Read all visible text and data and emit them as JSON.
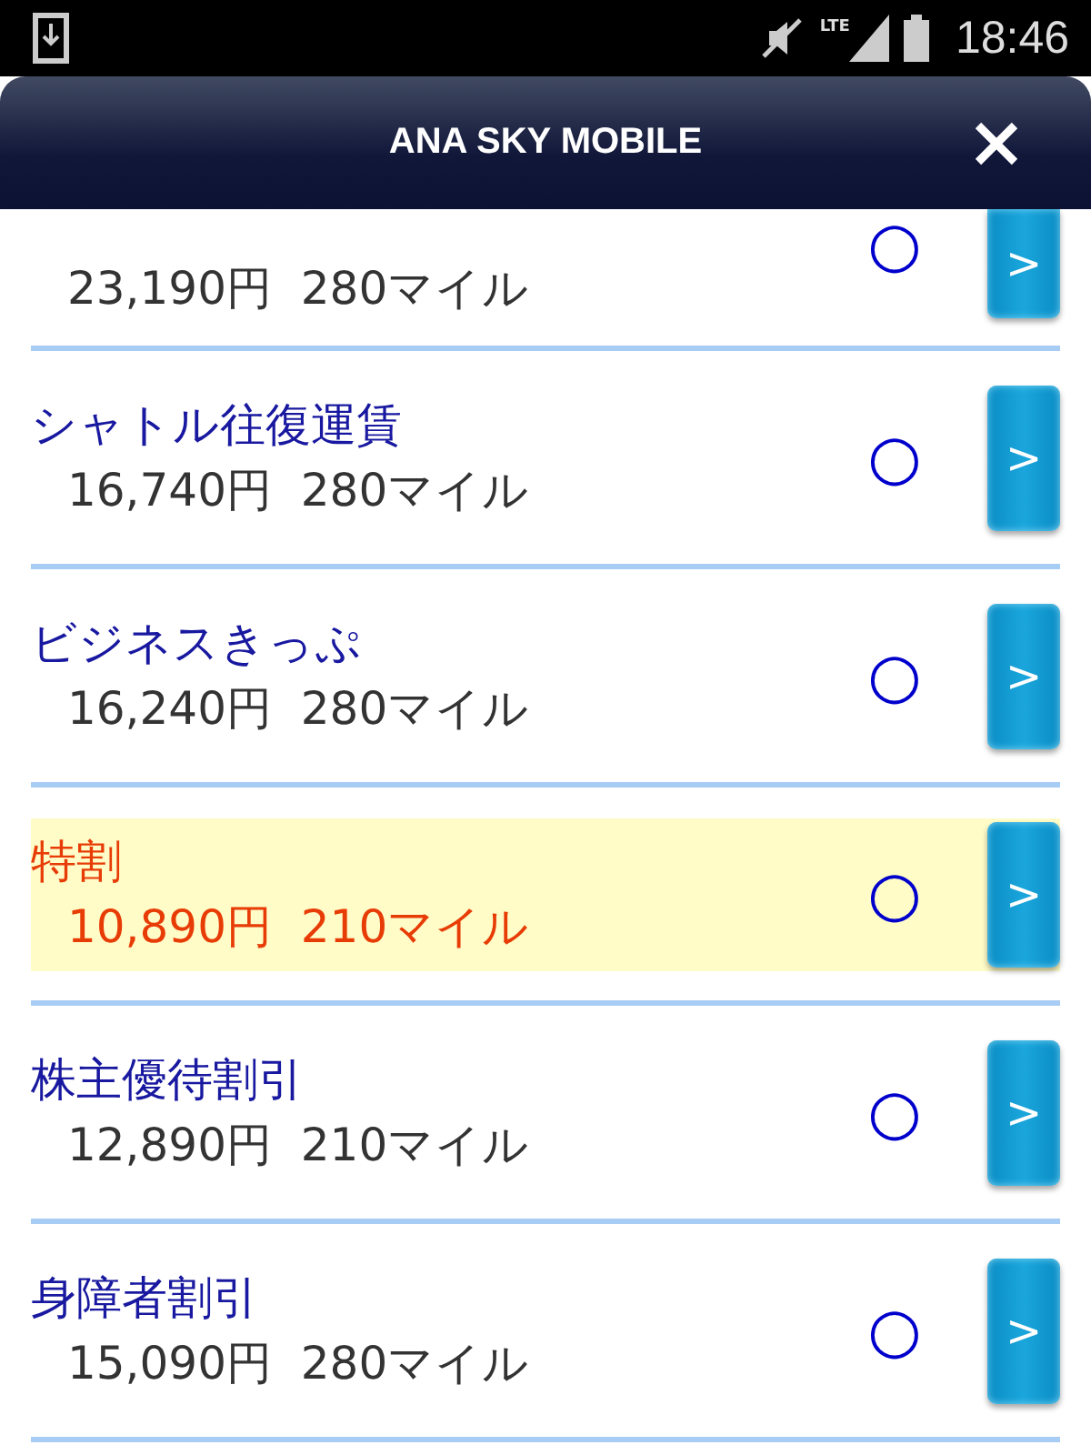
{
  "status_bar": {
    "network": "LTE",
    "time": "18:46"
  },
  "header": {
    "title": "ANA SKY MOBILE"
  },
  "fares": [
    {
      "kind": "partial",
      "price": "23,190円",
      "miles": "280マイル",
      "mark": "○",
      "action": ">",
      "selected": false
    },
    {
      "kind": "full",
      "name": "シャトル往復運賃",
      "price": "16,740円",
      "miles": "280マイル",
      "mark": "○",
      "action": ">",
      "selected": false
    },
    {
      "kind": "full",
      "name": "ビジネスきっぷ",
      "price": "16,240円",
      "miles": "280マイル",
      "mark": "○",
      "action": ">",
      "selected": false
    },
    {
      "kind": "full",
      "name": "特割",
      "price": "10,890円",
      "miles": "210マイル",
      "mark": "○",
      "action": ">",
      "selected": true
    },
    {
      "kind": "full",
      "name": "株主優待割引",
      "price": "12,890円",
      "miles": "210マイル",
      "mark": "○",
      "action": ">",
      "selected": false
    },
    {
      "kind": "full",
      "name": "身障者割引",
      "price": "15,090円",
      "miles": "280マイル",
      "mark": "○",
      "action": ">",
      "selected": false
    }
  ]
}
